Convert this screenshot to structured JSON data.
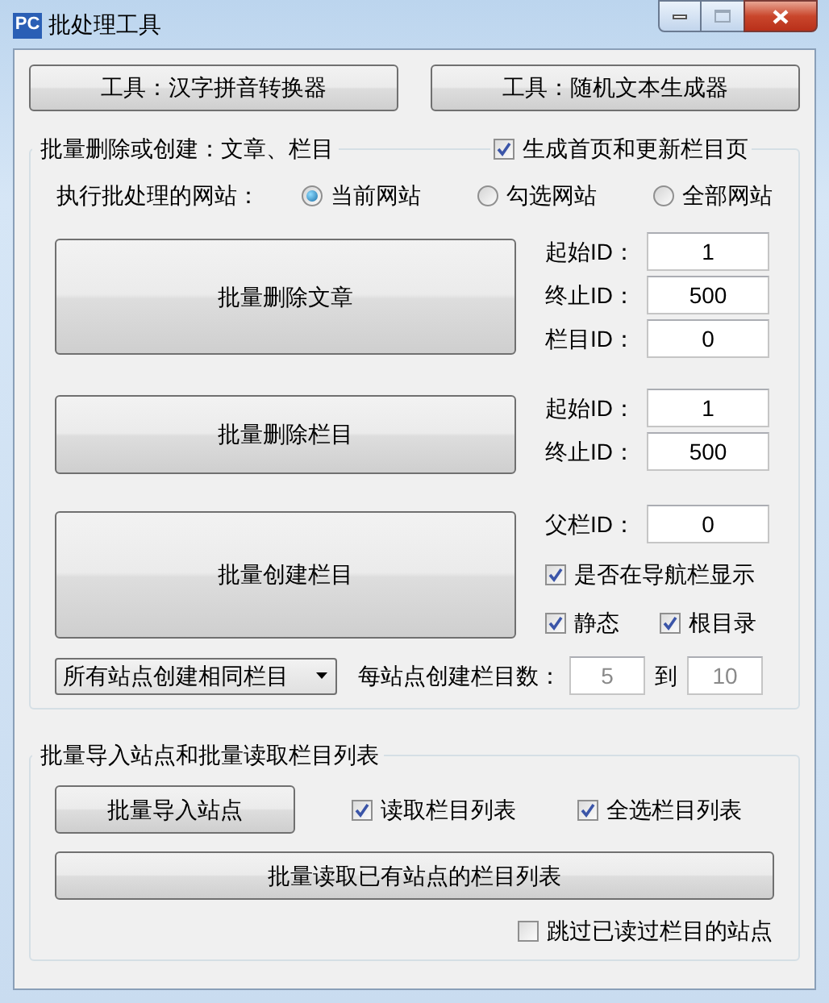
{
  "window": {
    "app_icon": "PC",
    "title": "批处理工具"
  },
  "tool_buttons": [
    "工具：汉字拼音转换器",
    "工具：随机文本生成器"
  ],
  "batch_group": {
    "legend": "批量删除或创建：文章、栏目",
    "generate_checkbox": {
      "label": "生成首页和更新栏目页",
      "checked": true
    },
    "site_label": "执行批处理的网站：",
    "site_options": [
      {
        "label": "当前网站",
        "selected": true
      },
      {
        "label": "勾选网站",
        "selected": false
      },
      {
        "label": "全部网站",
        "selected": false
      }
    ],
    "actions": [
      {
        "button": "批量删除文章",
        "fields": [
          {
            "label": "起始ID：",
            "value": "1"
          },
          {
            "label": "终止ID：",
            "value": "500"
          },
          {
            "label": "栏目ID：",
            "value": "0"
          }
        ]
      },
      {
        "button": "批量删除栏目",
        "fields": [
          {
            "label": "起始ID：",
            "value": "1"
          },
          {
            "label": "终止ID：",
            "value": "500"
          }
        ]
      },
      {
        "button": "批量创建栏目",
        "fields": [
          {
            "label": "父栏ID：",
            "value": "0"
          }
        ],
        "checkboxes": [
          {
            "label": "是否在导航栏显示",
            "checked": true
          },
          {
            "label": "静态",
            "checked": true
          },
          {
            "label": "根目录",
            "checked": true
          }
        ]
      }
    ],
    "mode_select": {
      "value": "所有站点创建相同栏目"
    },
    "count_label": "每站点创建栏目数：",
    "count_from": {
      "value": "5",
      "disabled": true
    },
    "to_label": "到",
    "count_to": {
      "value": "10",
      "disabled": true
    }
  },
  "import_group": {
    "legend": "批量导入站点和批量读取栏目列表",
    "import_button": "批量导入站点",
    "checkboxes": [
      {
        "label": "读取栏目列表",
        "checked": true
      },
      {
        "label": "全选栏目列表",
        "checked": true
      }
    ],
    "read_button": "批量读取已有站点的栏目列表",
    "skip_checkbox": {
      "label": "跳过已读过栏目的站点",
      "checked": false
    }
  }
}
